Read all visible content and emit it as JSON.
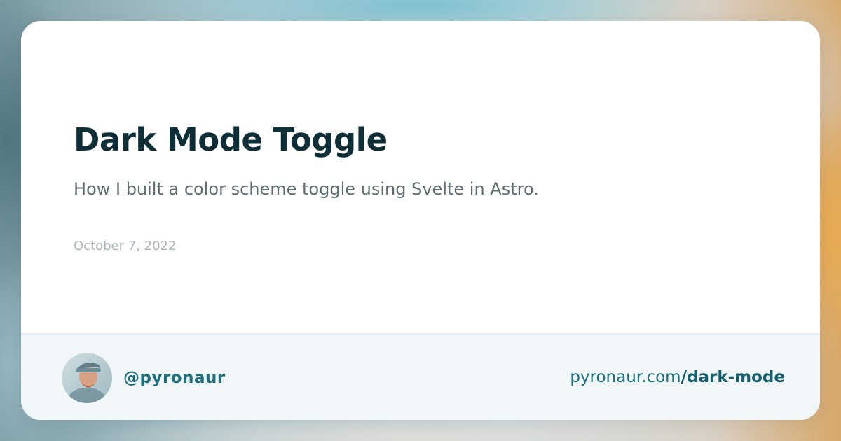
{
  "colors": {
    "title": "#0f2f38",
    "description": "#5d6e73",
    "date": "#a9b6ba",
    "accent": "#1c6f7e",
    "footer_background": "#f1f7f8"
  },
  "post": {
    "title": "Dark Mode Toggle",
    "description": "How I built a color scheme toggle using Svelte in Astro.",
    "date": "October 7, 2022"
  },
  "footer": {
    "avatar_icon": "author-photo",
    "handle": "@pyronaur",
    "url_domain": "pyronaur.com",
    "url_path": "/dark-mode"
  }
}
